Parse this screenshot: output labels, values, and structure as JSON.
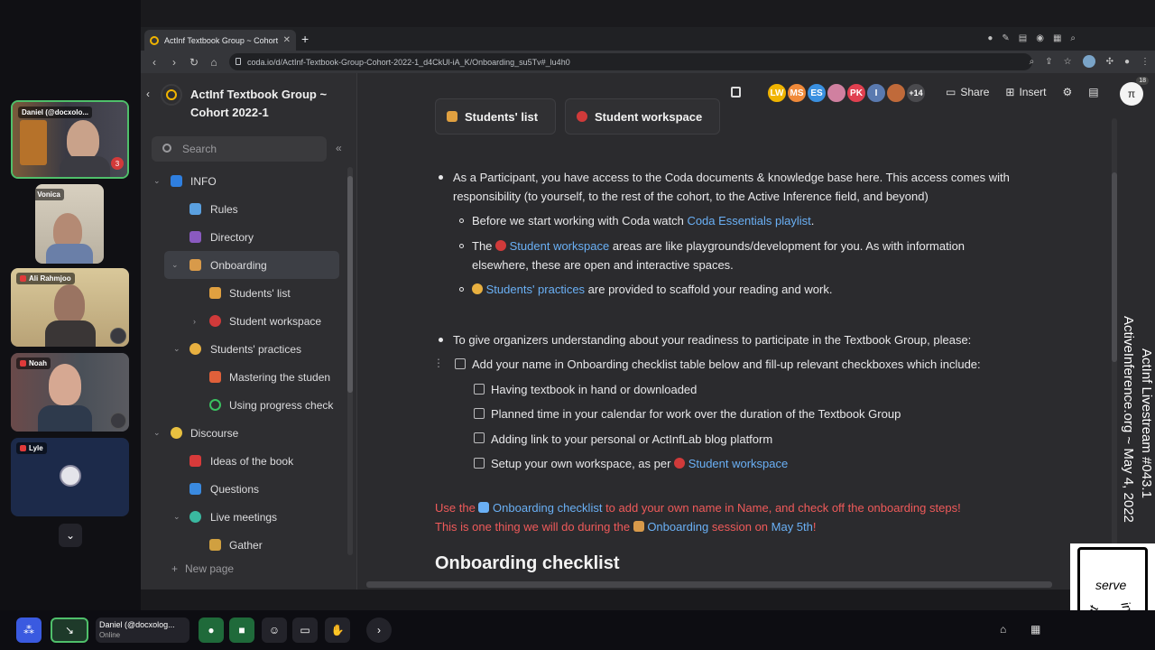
{
  "meeting": {
    "participants": [
      {
        "name": "Daniel (@docxolo...",
        "badge": "3"
      },
      {
        "name": "Ion Vonica"
      },
      {
        "name": "Ali Rahmjoo"
      },
      {
        "name": "Noah"
      },
      {
        "name": "Lyle"
      }
    ],
    "expand_icon": "chevron-down",
    "self": {
      "name": "Daniel (@docxolog...",
      "status": "Online"
    },
    "controls": [
      "apps-icon",
      "minimize-icon",
      "mic-icon",
      "camera-icon",
      "emoji-icon",
      "screen-share-icon",
      "raise-hand-icon",
      "next-icon"
    ]
  },
  "browser": {
    "tab_title": "ActInf Textbook Group ~ Cohort 20...",
    "tab_close": "✕",
    "new_tab": "+",
    "url": "coda.io/d/ActInf-Textbook-Group-Cohort-2022-1_d4CkUl-iA_K/Onboarding_su5Tv#_lu4h0"
  },
  "doc": {
    "title_line1": "ActInf Textbook Group ~",
    "title_line2": "Cohort 2022-1",
    "search_placeholder": "Search",
    "new_page": "New page",
    "nav": [
      {
        "label": "INFO",
        "chev": "⌄"
      },
      {
        "label": "Rules"
      },
      {
        "label": "Directory"
      },
      {
        "label": "Onboarding",
        "chev": "⌄"
      },
      {
        "label": "Students' list"
      },
      {
        "label": "Student workspace",
        "chev": "›"
      },
      {
        "label": "Students' practices",
        "chev": "⌄"
      },
      {
        "label": "Mastering the studen"
      },
      {
        "label": "Using progress check"
      },
      {
        "label": "Discourse",
        "chev": "⌄"
      },
      {
        "label": "Ideas of the book"
      },
      {
        "label": "Questions"
      },
      {
        "label": "Live meetings",
        "chev": "⌄"
      },
      {
        "label": "Gather"
      }
    ]
  },
  "topbar": {
    "avatars": [
      "LW",
      "MS",
      "ES",
      "",
      "PK",
      "I",
      ""
    ],
    "more_count": "+14",
    "share": "Share",
    "insert": "Insert",
    "badge": "18"
  },
  "content": {
    "buttons": [
      "Students' list",
      "Student workspace"
    ],
    "b1": "As a Participant, you have access to the Coda documents & knowledge base here. This access comes with",
    "b1_cont": "responsibility (to yourself, to the rest of the cohort, to the Active Inference field, and beyond)",
    "s1_pre": "Before we start working with Coda watch ",
    "s1_link": "Coda Essentials playlist",
    "s1_post": ".",
    "s2_pre": "The ",
    "s2_link": "Student workspace",
    "s2_post": " areas are like playgrounds/development for you. As with information",
    "s2_cont": "elsewhere, these are open and interactive spaces.",
    "s3_link": "Students' practices",
    "s3_post": " are provided to scaffold your reading and work.",
    "b2": "To give organizers understanding about your readiness to participate in the Textbook Group, please:",
    "c0": "Add your name in Onboarding checklist table below and fill-up relevant checkboxes which include:",
    "c1": "Having textbook in hand or downloaded",
    "c2": "Planned time in your calendar for work over the duration of the Textbook Group",
    "c3": "Adding link to your personal or ActInfLab blog platform",
    "c4_pre": "Setup your own workspace, as per ",
    "c4_link": "Student workspace",
    "r1_pre": "Use the ",
    "r1_link": "Onboarding checklist",
    "r1_post": " to add your own name in Name, and check off the onboarding steps!",
    "r2_pre": "This is one thing we will do during the ",
    "r2_link": "Onboarding",
    "r2_mid": " session on ",
    "r2_link2": "May 5th",
    "r2_post": "!",
    "heading": "Onboarding checklist"
  },
  "overlay": {
    "line1": "ActInf Livestream #043.1",
    "line2": "ActiveInference.org ~ May 4, 2022",
    "logo_words": [
      "act",
      "serve",
      "infer"
    ]
  },
  "colors": {
    "accent_green": "#4fbf6a",
    "link": "#6ab0f5",
    "red_text": "#ef5a5a"
  }
}
